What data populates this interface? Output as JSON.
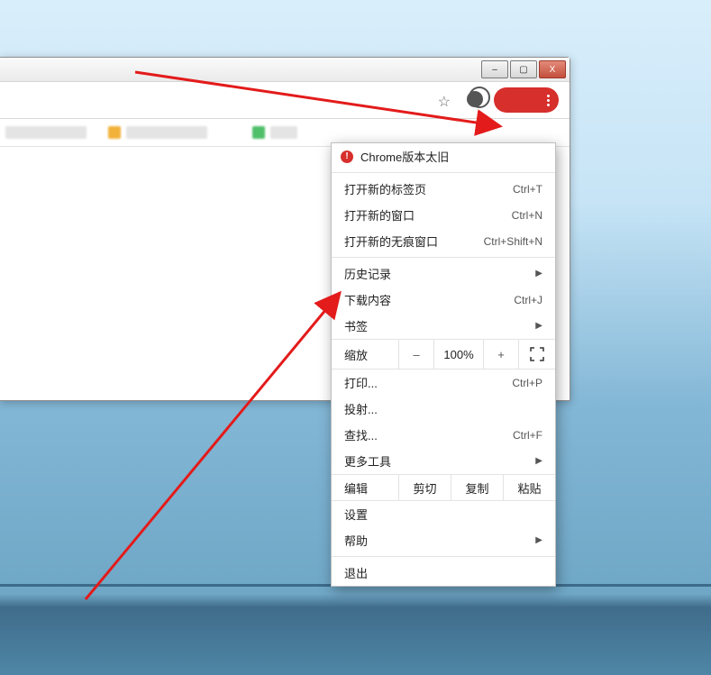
{
  "window_controls": {
    "minimize": "–",
    "maximize": "▢",
    "close": "X"
  },
  "toolbar": {
    "star_tooltip": "bookmark"
  },
  "menu": {
    "alert": "Chrome版本太旧",
    "new_tab": {
      "label": "打开新的标签页",
      "shortcut": "Ctrl+T"
    },
    "new_window": {
      "label": "打开新的窗口",
      "shortcut": "Ctrl+N"
    },
    "new_incognito": {
      "label": "打开新的无痕窗口",
      "shortcut": "Ctrl+Shift+N"
    },
    "history": {
      "label": "历史记录"
    },
    "downloads": {
      "label": "下载内容",
      "shortcut": "Ctrl+J"
    },
    "bookmarks": {
      "label": "书签"
    },
    "zoom": {
      "label": "缩放",
      "minus": "–",
      "value": "100%",
      "plus": "+"
    },
    "print": {
      "label": "打印...",
      "shortcut": "Ctrl+P"
    },
    "cast": {
      "label": "投射..."
    },
    "find": {
      "label": "查找...",
      "shortcut": "Ctrl+F"
    },
    "more_tools": {
      "label": "更多工具"
    },
    "edit": {
      "label": "编辑",
      "cut": "剪切",
      "copy": "复制",
      "paste": "粘贴"
    },
    "settings": {
      "label": "设置"
    },
    "help": {
      "label": "帮助"
    },
    "exit": {
      "label": "退出"
    }
  }
}
